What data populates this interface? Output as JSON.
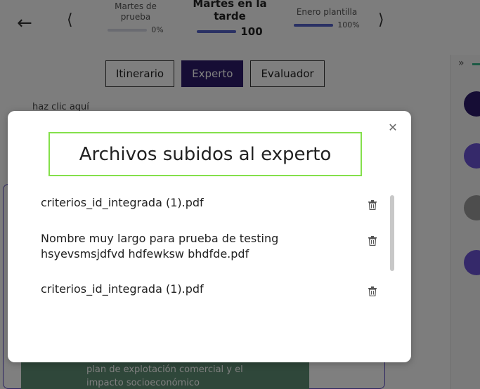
{
  "header": {
    "back_icon": "arrow-left-icon",
    "steps": [
      {
        "title": "Martes de prueba",
        "percent": "0%",
        "progress": 0
      },
      {
        "title": "Martes en la tarde",
        "percent": "100",
        "progress": 100
      },
      {
        "title": "Enero plantilla",
        "percent": "100%",
        "progress": 100
      }
    ]
  },
  "tabs": [
    {
      "label": "Itinerario",
      "active": false
    },
    {
      "label": "Experto",
      "active": true
    },
    {
      "label": "Evaluador",
      "active": false
    }
  ],
  "background": {
    "peek_text": "haz clic aquí",
    "green_text_1": "plan de explotación comercial y el",
    "green_text_2": "impacto socioeconómico"
  },
  "modal": {
    "title": "Archivos subidos al experto",
    "close_icon": "close-icon",
    "files": [
      {
        "name": "criterios_id_integrada (1).pdf"
      },
      {
        "name": "Nombre muy largo para prueba de testing hsyevsmsjdfvd hdfewksw bhdfde.pdf"
      },
      {
        "name": "criterios_id_integrada (1).pdf"
      }
    ]
  },
  "colors": {
    "active_tab": "#2d1b6b",
    "progress_fill": "#5563c8",
    "title_outline": "#84e04b",
    "green_box": "#5f8f74",
    "accent_purple": "#5b4ac2"
  }
}
